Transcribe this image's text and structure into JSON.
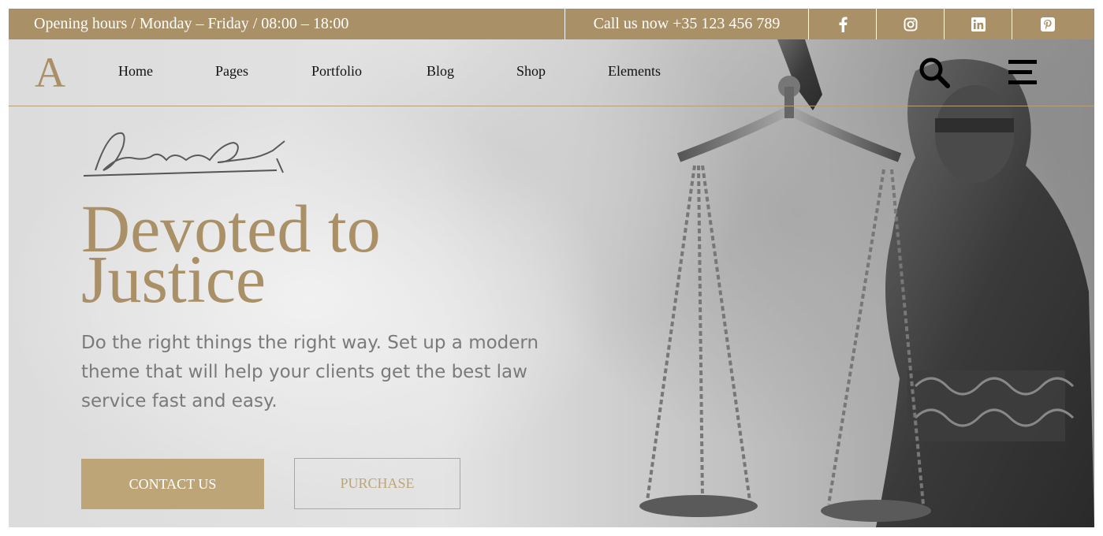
{
  "topbar": {
    "hours": "Opening hours / Monday – Friday / 08:00 – 18:00",
    "call": "Call us now +35 123 456 789",
    "social": [
      "facebook-icon",
      "instagram-icon",
      "linkedin-icon",
      "pinterest-icon"
    ],
    "background": "#aa9066"
  },
  "nav": {
    "logo": "A",
    "items": [
      "Home",
      "Pages",
      "Portfolio",
      "Blog",
      "Shop",
      "Elements"
    ],
    "icons": [
      "search-icon",
      "hamburger-menu-icon"
    ]
  },
  "hero": {
    "headline_line1": "Devoted to",
    "headline_line2": "Justice",
    "subtext": "Do the right things the right way. Set up a modern theme that will help your clients get the best law service fast and easy.",
    "contact_label": "CONTACT US",
    "purchase_label": "PURCHASE",
    "accent_color": "#aa9066"
  }
}
